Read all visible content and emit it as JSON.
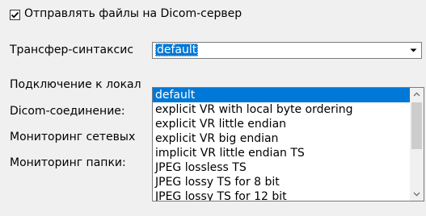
{
  "send_checkbox": {
    "label": "Отправлять файлы на Dicom-сервер",
    "checked": true
  },
  "transfer_syntax": {
    "label": "Трансфер-синтаксис",
    "value": "default",
    "options": [
      "default",
      "explicit VR  with local byte ordering",
      "explicit VR little endian",
      "explicit VR big endian",
      "implicit VR little endian TS",
      "JPEG lossless TS",
      "JPEG lossy TS for 8 bit",
      "JPEG lossy TS for 12 bit"
    ],
    "selected_index": 0
  },
  "rows": {
    "local_connection_label": "Подключение к локал",
    "dicom_connection_label": "Dicom-соединение:",
    "network_monitoring_label": "Мониторинг сетевых",
    "folder_monitoring_label": "Мониторинг папки:"
  },
  "icons": {
    "check": "check-icon",
    "dropdown_arrow": "chevron-down-icon",
    "scroll_up": "scroll-up-arrow-icon",
    "scroll_down": "scroll-down-arrow-icon"
  },
  "colors": {
    "selection": "#0078d7",
    "background": "#f0f0f0"
  }
}
